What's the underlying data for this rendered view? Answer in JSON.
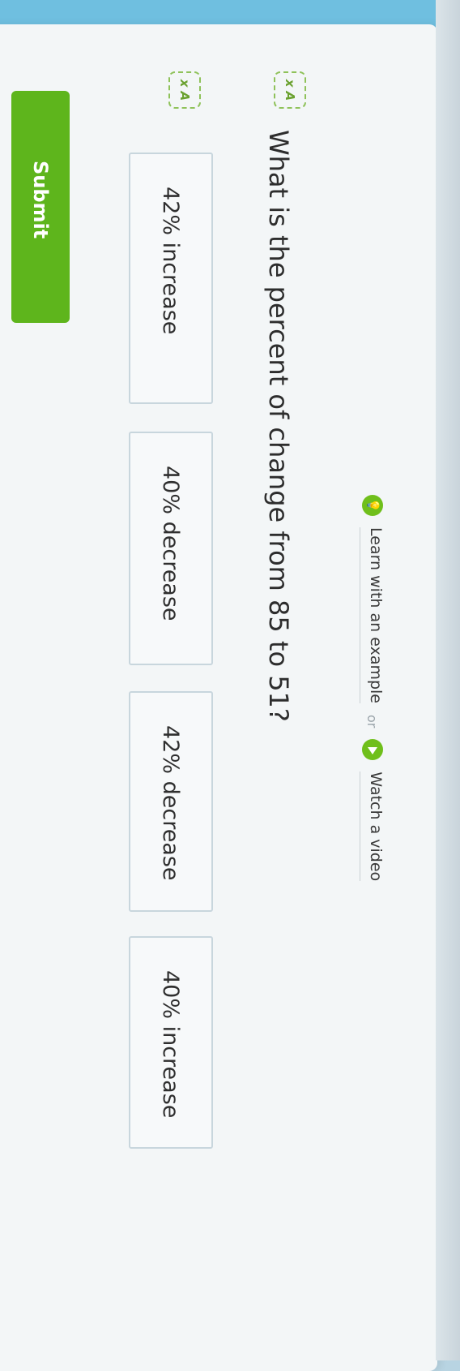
{
  "help": {
    "learn_label": "Learn with an example",
    "or_label": "or",
    "video_label": "Watch a video",
    "learn_icon": "lightbulb-icon",
    "video_icon": "play-icon"
  },
  "tts_icon_label": "x A",
  "question": "What is the percent of change from 85 to 51?",
  "choices": [
    "42% increase",
    "40% decrease",
    "42% decrease",
    "40% increase"
  ],
  "submit_label": "Submit",
  "colors": {
    "accent_green": "#5eb51c",
    "top_band": "#6fbfe0"
  }
}
